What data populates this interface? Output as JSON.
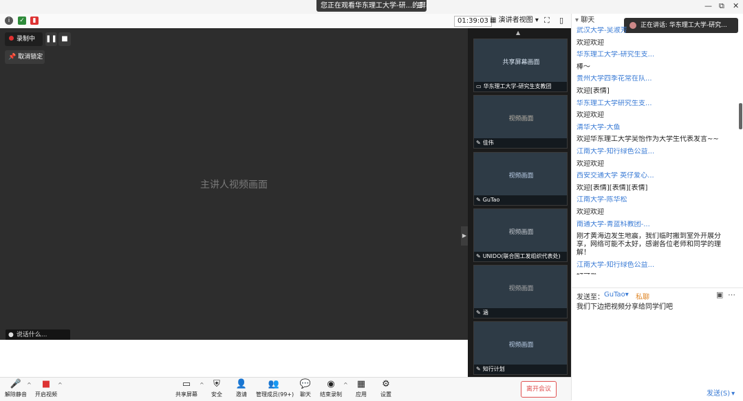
{
  "titlebar": {
    "share_banner": "您正在观看华东理工大学-研...的屏幕",
    "minimize": "—",
    "restore": "⧉",
    "close": "✕"
  },
  "statusbar": {
    "timer": "01:39:03",
    "view_label": "演讲者视图",
    "view_caret": "▾"
  },
  "main_video": {
    "recording_label": "录制中",
    "unpin_label": "取消锁定",
    "speaker_name_label": "说话什么...",
    "video_placeholder": "主讲人视频画面"
  },
  "thumbnails": [
    {
      "label": "华东理工大学-研究生支教团",
      "placeholder": "共享屏幕画面",
      "bg": "#2a5d8f"
    },
    {
      "label": "佳伟",
      "placeholder": "视频画面",
      "bg": "#2b2620"
    },
    {
      "label": "GuTao",
      "placeholder": "视频画面",
      "bg": "#10407a"
    },
    {
      "label": "UNIDO(联合国工发组织代表处)",
      "placeholder": "视频画面",
      "bg": "#3b3f48"
    },
    {
      "label": "涵",
      "placeholder": "视频画面",
      "bg": "#2f2f2f"
    },
    {
      "label": "知行计划",
      "placeholder": "视频画面",
      "bg": "#1d5aa0"
    }
  ],
  "chat": {
    "header_label": "聊天",
    "speaking_label": "正在讲话: 华东理工大学-研究...",
    "messages": [
      {
        "type": "sender",
        "text": "武汉大学-吴淑芳"
      },
      {
        "type": "text",
        "text": "欢迎欢迎"
      },
      {
        "type": "sender",
        "text": "华东理工大学-研究生支..."
      },
      {
        "type": "text",
        "text": "棒～"
      },
      {
        "type": "sender",
        "text": "贵州大学四季花常在队..."
      },
      {
        "type": "text",
        "text": "欢迎[表情]"
      },
      {
        "type": "sender",
        "text": "华东理工大学研究生支..."
      },
      {
        "type": "text",
        "text": "欢迎欢迎"
      },
      {
        "type": "sender",
        "text": "清华大学-大鱼"
      },
      {
        "type": "text",
        "text": "欢迎华东理工大学吴怡作为大学生代表发言~~"
      },
      {
        "type": "sender",
        "text": "江南大学-知行绿色公益..."
      },
      {
        "type": "text",
        "text": "欢迎欢迎"
      },
      {
        "type": "sender",
        "text": "西安交通大学 英仔爱心..."
      },
      {
        "type": "text",
        "text": "欢迎[表情][表情][表情]"
      },
      {
        "type": "sender",
        "text": "江南大学-陈华松"
      },
      {
        "type": "text",
        "text": "欢迎欢迎"
      },
      {
        "type": "sender",
        "text": "南通大学-青蓝科教团-..."
      },
      {
        "type": "wrap",
        "text": "刚才黄海边发生地震，我们临时搬到室外开展分享，网络可能不太好，感谢各位老师和同学的理解！"
      },
      {
        "type": "sender",
        "text": "江南大学-知行绿色公益..."
      },
      {
        "type": "text",
        "text": "好可爱"
      }
    ],
    "send_to_label": "发送至：",
    "send_to_target": "GuTao",
    "send_to_caret": "▾",
    "private_label": "私聊",
    "input_value": "我们下边把视频分享给同学们吧",
    "send_button": "发送(S)"
  },
  "toolbar": {
    "unmute": "解除静音",
    "start_video": "开启视频",
    "share_screen": "共享屏幕",
    "security": "安全",
    "invite": "邀请",
    "manage_participants": "管理成员(99+)",
    "chat": "聊天",
    "end_recording": "结束录制",
    "apps": "应用",
    "settings": "设置",
    "leave": "离开会议"
  },
  "colors": {
    "accent_blue": "#3a7bd5",
    "leave_red": "#e05050",
    "recording_red": "#e03030"
  }
}
